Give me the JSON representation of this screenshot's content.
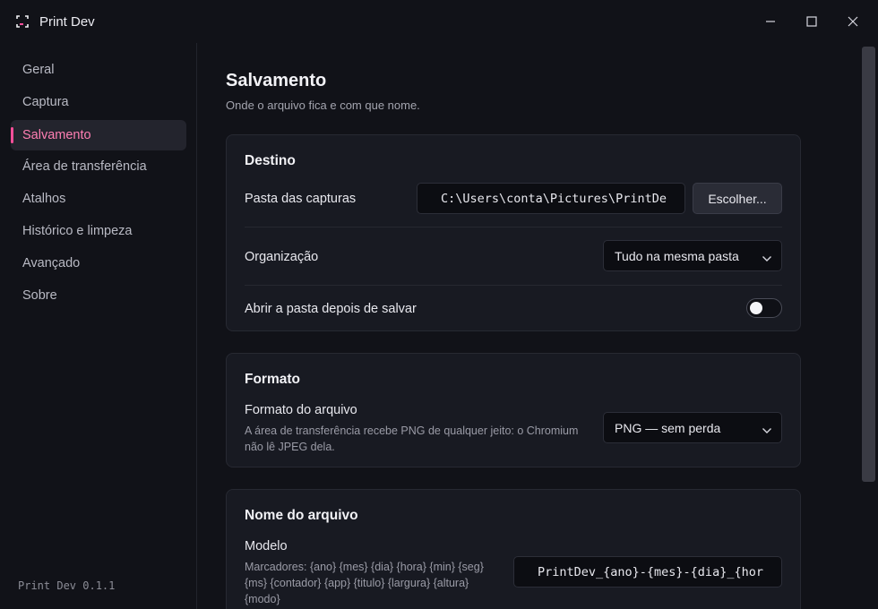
{
  "window": {
    "title": "Print Dev",
    "icon": "print-dev-logo",
    "controls": [
      "minimize-icon",
      "maximize-icon",
      "close-icon"
    ]
  },
  "sidebar": {
    "items": [
      {
        "label": "Geral",
        "active": false
      },
      {
        "label": "Captura",
        "active": false
      },
      {
        "label": "Salvamento",
        "active": true
      },
      {
        "label": "Área de transferência",
        "active": false
      },
      {
        "label": "Atalhos",
        "active": false
      },
      {
        "label": "Histórico e limpeza",
        "active": false
      },
      {
        "label": "Avançado",
        "active": false
      },
      {
        "label": "Sobre",
        "active": false
      }
    ],
    "version": "Print Dev 0.1.1"
  },
  "page": {
    "title": "Salvamento",
    "subtitle": "Onde o arquivo fica e com que nome."
  },
  "destino": {
    "title": "Destino",
    "folder_label": "Pasta das capturas",
    "folder_value": "C:\\Users\\conta\\Pictures\\PrintDe",
    "choose_label": "Escolher...",
    "org_label": "Organização",
    "org_value": "Tudo na mesma pasta",
    "open_label": "Abrir a pasta depois de salvar",
    "open_enabled": false
  },
  "formato": {
    "title": "Formato",
    "format_label": "Formato do arquivo",
    "format_hint_1": "A área de transferência recebe PNG de qualquer jeito: o Chromium",
    "format_hint_2": "não lê JPEG dela.",
    "format_value": "PNG — sem perda"
  },
  "nome": {
    "title": "Nome do arquivo",
    "model_label": "Modelo",
    "model_hint_1": "Marcadores: {ano} {mes} {dia} {hora} {min} {seg}",
    "model_hint_2": "{ms} {contador} {app} {titulo} {largura} {altura}",
    "model_hint_3": "{modo}",
    "model_value": "PrintDev_{ano}-{mes}-{dia}_{hor"
  },
  "colors": {
    "accent": "#ff4f9a",
    "active_text": "#ff7fb3",
    "background": "#111218",
    "card": "#181a22"
  }
}
